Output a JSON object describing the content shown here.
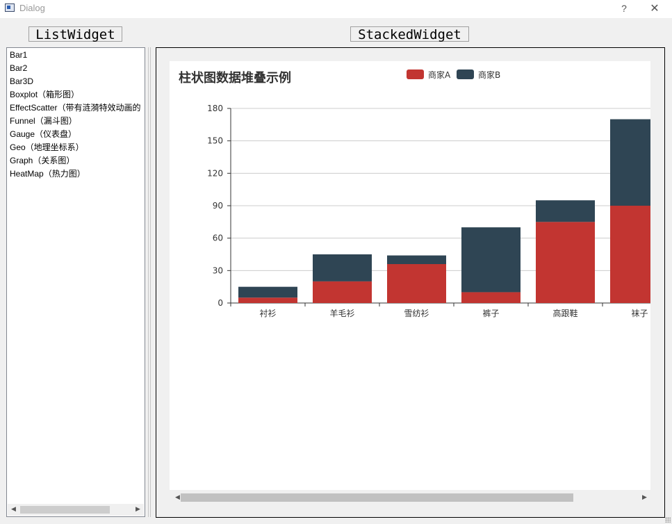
{
  "window": {
    "title": "Dialog",
    "help_label": "?",
    "close_label": "✕"
  },
  "labels": {
    "list_widget": "ListWidget",
    "stacked_widget": "StackedWidget"
  },
  "list": {
    "items": [
      "Bar1",
      "Bar2",
      "Bar3D",
      "Boxplot（箱形图）",
      "EffectScatter（带有涟漪特效动画的",
      "Funnel（漏斗图）",
      "Gauge（仪表盘）",
      "Geo（地理坐标系）",
      "Graph（关系图）",
      "HeatMap（热力图）"
    ],
    "scroll_left": "◀",
    "scroll_right": "▶"
  },
  "webview_scroll": {
    "left": "◀",
    "right": "▶"
  },
  "chart_data": {
    "type": "bar",
    "stacked": true,
    "title": "柱状图数据堆叠示例",
    "categories": [
      "衬衫",
      "羊毛衫",
      "雪纺衫",
      "裤子",
      "高跟鞋",
      "袜子"
    ],
    "series": [
      {
        "name": "商家A",
        "color": "#c23531",
        "values": [
          5,
          20,
          36,
          10,
          75,
          90
        ]
      },
      {
        "name": "商家B",
        "color": "#2f4554",
        "values": [
          10,
          25,
          8,
          60,
          20,
          80
        ]
      }
    ],
    "ylim": [
      0,
      180
    ],
    "yticks": [
      0,
      30,
      60,
      90,
      120,
      150,
      180
    ],
    "legend_position": "top-center",
    "grid": true
  }
}
